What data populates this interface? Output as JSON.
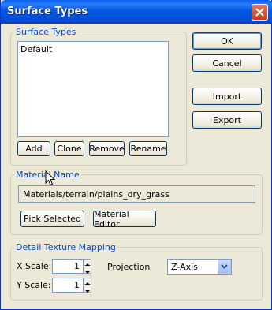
{
  "window": {
    "title": "Surface Types"
  },
  "surface_types": {
    "legend": "Surface Types",
    "items": [
      "Default"
    ],
    "add_label": "Add",
    "clone_label": "Clone",
    "remove_label": "Remove",
    "rename_label": "Rename"
  },
  "side_buttons": {
    "ok": "OK",
    "cancel": "Cancel",
    "import": "Import",
    "export": "Export"
  },
  "material": {
    "legend": "Material Name",
    "value": "Materials/terrain/plains_dry_grass",
    "pick_label": "Pick Selected",
    "editor_label": "Material Editor"
  },
  "detail": {
    "legend": "Detail Texture Mapping",
    "x_label": "X Scale:",
    "x_value": "1",
    "y_label": "Y Scale:",
    "y_value": "1",
    "projection_label": "Projection",
    "projection_value": "Z-Axis"
  },
  "colors": {
    "titlebar": "#0058e6",
    "legend": "#0046d5",
    "dialog_bg": "#ece9d8"
  }
}
